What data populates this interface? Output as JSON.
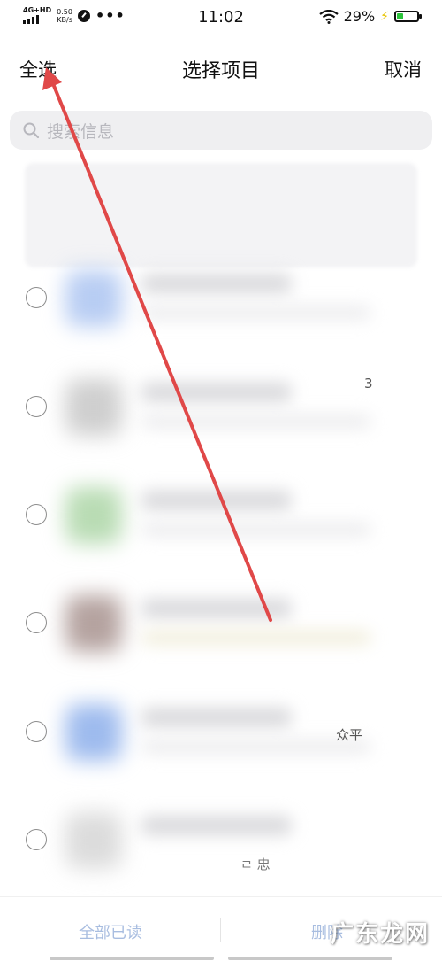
{
  "status_bar": {
    "network": "4G+HD",
    "speed_value": "0.50",
    "speed_unit": "KB/s",
    "more": "•••",
    "time": "11:02",
    "battery_percent": "29%",
    "battery_level": 0.29,
    "icons": [
      "signal-icon",
      "data-monitor-icon",
      "wifi-icon",
      "charging-bolt-icon",
      "battery-icon"
    ]
  },
  "header": {
    "select_all": "全选",
    "title": "选择项目",
    "cancel": "取消"
  },
  "search": {
    "placeholder": "搜索信息"
  },
  "list": {
    "fragments": [
      "3",
      "众平",
      "ㄹ 忠"
    ]
  },
  "bottom_bar": {
    "mark_all_read": "全部已读",
    "delete": "删除"
  },
  "watermark": "广东龙网",
  "colors": {
    "accent_disabled": "#a8bde0",
    "annotation_arrow": "#e04848",
    "search_bg": "#efeff1"
  }
}
